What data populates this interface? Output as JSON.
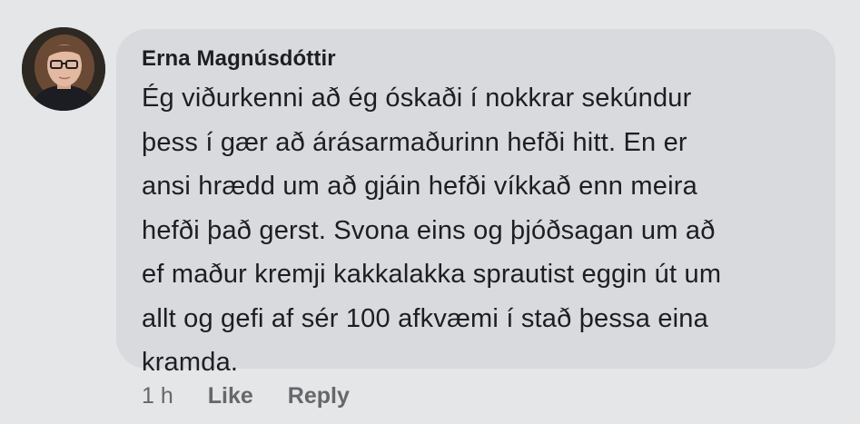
{
  "comment": {
    "author": "Erna Magnúsdóttir",
    "text_lines": [
      "Ég viðurkenni að ég óskaði í nokkrar sekúndur",
      "þess í gær að árásarmaðurinn hefði hitt. En er",
      "ansi hrædd um að gjáin hefði víkkað enn meira",
      "hefði það gerst. Svona eins og þjóðsagan um að",
      "ef maður kremji kakkalakka sprautist eggin út um",
      "allt og gefi af sér 100 afkvæmi í stað þessa eina",
      "kramda."
    ],
    "timestamp": "1 h",
    "like_label": "Like",
    "reply_label": "Reply"
  },
  "colors": {
    "page_background": "#e4e6e8",
    "bubble_background": "#d8dadd",
    "text": "#1c1e21",
    "secondary_text": "#65676b"
  },
  "icons": {
    "avatar": "profile-photo"
  }
}
